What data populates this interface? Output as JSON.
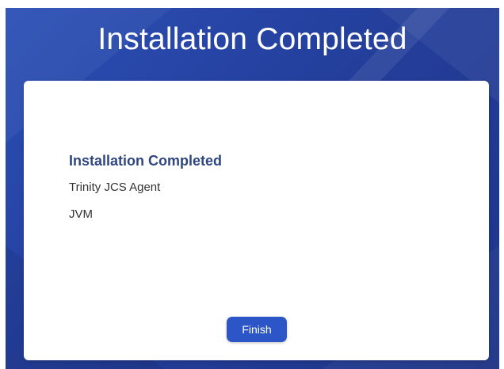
{
  "header": {
    "title": "Installation Completed"
  },
  "content": {
    "heading": "Installation Completed",
    "components": [
      "Trinity JCS Agent",
      "JVM"
    ]
  },
  "actions": {
    "finish_label": "Finish"
  },
  "colors": {
    "background_primary": "#2b4fb6",
    "background_dark": "#1e3486",
    "heading_text": "#2f4680",
    "button_bg": "#2c55c7",
    "card_bg": "#ffffff"
  }
}
